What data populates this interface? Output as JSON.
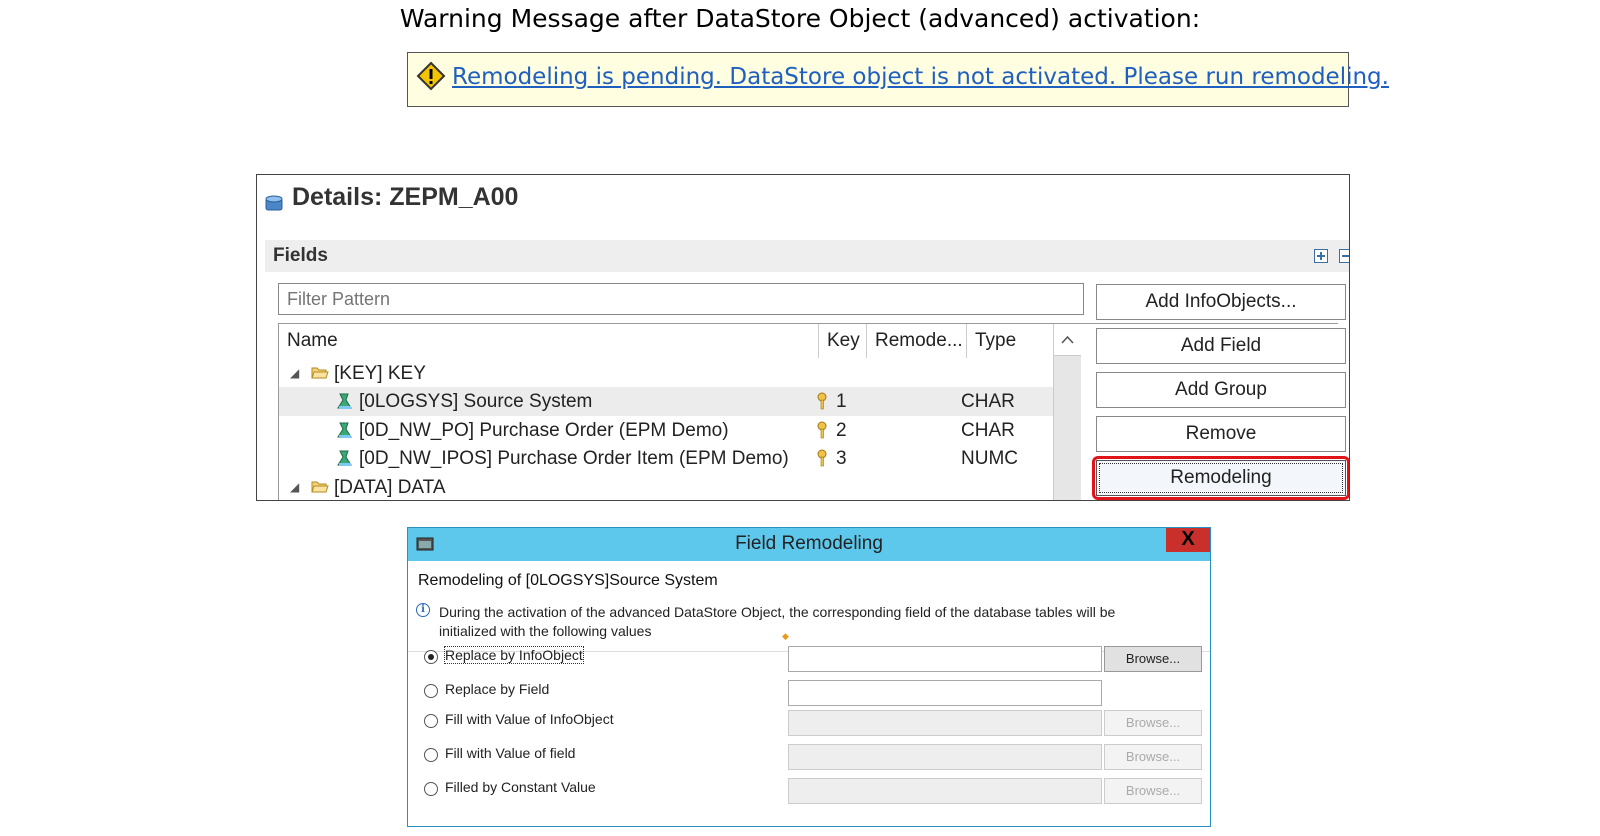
{
  "heading": "Warning Message after DataStore Object (advanced) activation:",
  "warning": {
    "icon": "warning-diamond-icon",
    "message": "Remodeling is pending. DataStore object is not activated. Please run remodeling."
  },
  "details": {
    "title": "Details: ZEPM_A00",
    "fields_label": "Fields",
    "filter_placeholder": "Filter Pattern",
    "columns": [
      "Name",
      "Key",
      "Remode...",
      "Type"
    ],
    "rows": [
      {
        "name": "[KEY] KEY",
        "key": "",
        "type": ""
      },
      {
        "name": "[0LOGSYS] Source System",
        "key": "1",
        "type": "CHAR"
      },
      {
        "name": "[0D_NW_PO] Purchase Order (EPM Demo)",
        "key": "2",
        "type": "CHAR"
      },
      {
        "name": "[0D_NW_IPOS] Purchase Order Item (EPM Demo)",
        "key": "3",
        "type": "NUMC"
      },
      {
        "name": "[DATA] DATA",
        "key": "",
        "type": ""
      }
    ],
    "buttons": [
      "Add InfoObjects...",
      "Add Field",
      "Add Group",
      "Remove",
      "Remodeling"
    ],
    "highlight_color": "#e0141a"
  },
  "dialog": {
    "title": "Field Remodeling",
    "close": "X",
    "subtitle": "Remodeling of [0LOGSYS]Source System",
    "info": "During the activation of the advanced DataStore Object, the corresponding field of the database tables will be initialized with the following values",
    "options": [
      {
        "label": "Replace by InfoObject",
        "browse": "Browse..."
      },
      {
        "label": "Replace by Field",
        "browse": ""
      },
      {
        "label": "Fill with Value of InfoObject",
        "browse": "Browse..."
      },
      {
        "label": "Fill with Value of field",
        "browse": "Browse..."
      },
      {
        "label": "Filled by Constant Value",
        "browse": "Browse..."
      }
    ],
    "titlebar_color": "#5ec8ec"
  }
}
